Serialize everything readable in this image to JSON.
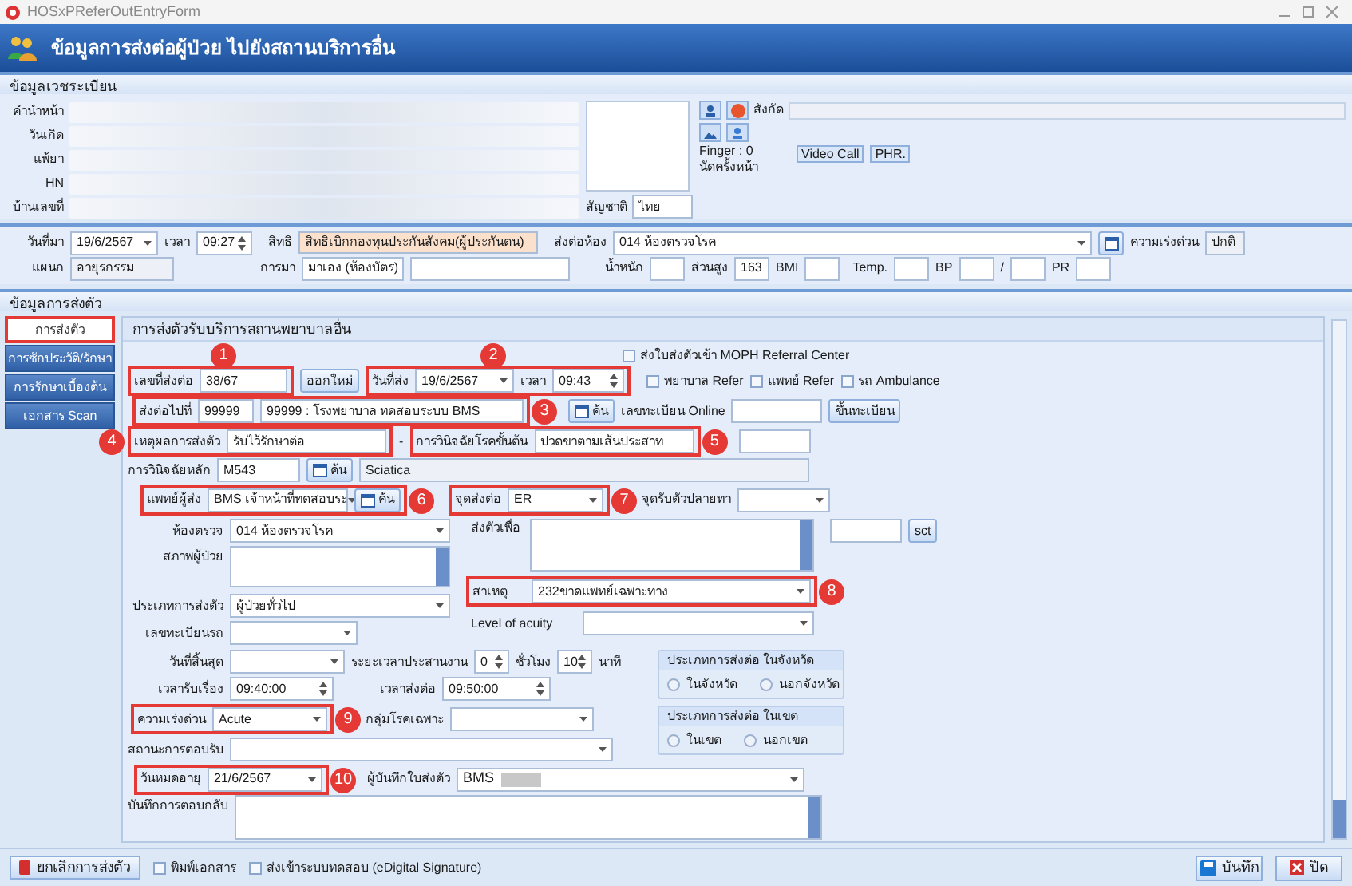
{
  "window": {
    "title": "HOSxPReferOutEntryForm"
  },
  "header": {
    "title": "ข้อมูลการส่งต่อผู้ป่วย ไปยังสถานบริการอื่น"
  },
  "registry": {
    "title": "ข้อมูลเวชระเบียน",
    "labels": [
      "คำนำหน้า",
      "วันเกิด",
      "แพ้ยา",
      "HN",
      "บ้านเลขที่"
    ],
    "affiliation_label": "สังกัด",
    "finger": "Finger : 0",
    "next_appointment_label": "นัดครั้งหน้า",
    "buttons": [
      "Video Call",
      "PHR."
    ],
    "nationality": {
      "label": "สัญชาติ",
      "value": "ไทย"
    }
  },
  "visit": {
    "date": {
      "label": "วันที่มา",
      "value": "19/6/2567"
    },
    "time": {
      "label": "เวลา",
      "value": "09:27"
    },
    "right": {
      "label": "สิทธิ",
      "value": "สิทธิเบิกกองทุนประกันสังคม(ผู้ประกันตน)"
    },
    "room": {
      "label": "ส่งต่อห้อง",
      "value": "014 ห้องตรวจโรค"
    },
    "urgency": {
      "label": "ความเร่งด่วน",
      "value": "ปกติ"
    },
    "department": {
      "label": "แผนก",
      "value": "อายุรกรรม"
    },
    "arrival": {
      "label": "การมา",
      "value": "มาเอง (ห้องบัตร)"
    },
    "weight": {
      "label": "น้ำหนัก"
    },
    "height": {
      "label": "ส่วนสูง",
      "value": "163"
    },
    "bmi": {
      "label": "BMI"
    },
    "temp": {
      "label": "Temp."
    },
    "bp": {
      "label": "BP",
      "separator": "/"
    },
    "pr": {
      "label": "PR"
    }
  },
  "referral": {
    "section_title": "ข้อมูลการส่งตัว",
    "tabs": [
      {
        "label": "การส่งตัว",
        "selected": true
      },
      {
        "label": "การซักประวัติ/รักษา",
        "selected": false
      },
      {
        "label": "การรักษาเบื้องต้น",
        "selected": false
      },
      {
        "label": "เอกสาร Scan",
        "selected": false
      }
    ],
    "group_title": "การส่งตัวรับบริการสถานพยาบาลอื่น",
    "refer_no": {
      "label": "เลขที่ส่งต่อ",
      "value": "38/67"
    },
    "new_button": "ออกใหม่",
    "send_date": {
      "label": "วันที่ส่ง",
      "value": "19/6/2567"
    },
    "send_time": {
      "label": "เวลา",
      "value": "09:43"
    },
    "checks": [
      {
        "label": "ส่งใบส่งตัวเข้า MOPH Referral Center",
        "checked": false
      },
      {
        "label": "พยาบาล Refer",
        "checked": false
      },
      {
        "label": "แพทย์ Refer",
        "checked": false
      },
      {
        "label": "รถ Ambulance",
        "checked": false
      }
    ],
    "destination": {
      "label": "ส่งต่อไปที่",
      "code": "99999",
      "name": "99999 : โรงพยาบาล ทดสอบระบบ BMS",
      "button": "ค้น"
    },
    "online_reg": {
      "label": "เลขทะเบียน Online",
      "button": "ขึ้นทะเบียน"
    },
    "reason": {
      "label": "เหตุผลการส่งตัว",
      "value": "รับไว้รักษาต่อ"
    },
    "dash": "-",
    "initial_dx": {
      "label": "การวินิจฉัยโรคขั้นต้น",
      "value": "ปวดขาตามเส้นประสาท"
    },
    "main_dx": {
      "label": "การวินิจฉัยหลัก",
      "code": "M543",
      "button": "ค้น",
      "name": "Sciatica"
    },
    "doctor": {
      "label": "แพทย์ผู้ส่ง",
      "value": "BMS เจ้าหน้าที่ทดสอบระ",
      "button": "ค้น"
    },
    "send_point": {
      "label": "จุดส่งต่อ",
      "value": "ER"
    },
    "receive_point": {
      "label": "จุดรับตัวปลายทา"
    },
    "exam_room": {
      "label": "ห้องตรวจ",
      "value": "014 ห้องตรวจโรค"
    },
    "purpose": {
      "label": "ส่งตัวเพื่อ",
      "button": "sct"
    },
    "condition": {
      "label": "สภาพผู้ป่วย"
    },
    "refer_type": {
      "label": "ประเภทการส่งตัว",
      "value": "ผู้ป่วยทั่วไป"
    },
    "cause": {
      "label": "สาเหตุ",
      "value": "232ขาดแพทย์เฉพาะทาง"
    },
    "vehicle": {
      "label": "เลขทะเบียนรถ"
    },
    "acuity": {
      "label": "Level of acuity"
    },
    "end_date": {
      "label": "วันที่สิ้นสุด"
    },
    "coordination": {
      "label": "ระยะเวลาประสานงาน",
      "hours": "0",
      "hours_unit": "ชั่วโมง",
      "minutes": "10",
      "minutes_unit": "นาที"
    },
    "receive_time": {
      "label": "เวลารับเรื่อง",
      "value": "09:40:00"
    },
    "refer_time": {
      "label": "เวลาส่งต่อ",
      "value": "09:50:00"
    },
    "severity": {
      "label": "ความเร่งด่วน",
      "value": "Acute"
    },
    "disease_group": {
      "label": "กลุ่มโรคเฉพาะ"
    },
    "response_status": {
      "label": "สถานะการตอบรับ"
    },
    "expiry": {
      "label": "วันหมดอายุ",
      "value": "21/6/2567"
    },
    "recorder": {
      "label": "ผู้บันทึกใบส่งตัว",
      "value": "BMS"
    },
    "reply_note": {
      "label": "บันทึกการตอบกลับ"
    },
    "province_group": {
      "title": "ประเภทการส่งต่อ ในจังหวัด",
      "options": [
        {
          "label": "ในจังหวัด",
          "selected": false
        },
        {
          "label": "นอกจังหวัด",
          "selected": false
        }
      ]
    },
    "region_group": {
      "title": "ประเภทการส่งต่อ ในเขต",
      "options": [
        {
          "label": "ในเขต",
          "selected": false
        },
        {
          "label": "นอกเขต",
          "selected": false
        }
      ]
    }
  },
  "footer": {
    "cancel_button": "ยกเลิกการส่งตัว",
    "checks": [
      {
        "label": "พิมพ์เอกสาร",
        "checked": false
      },
      {
        "label": "ส่งเข้าระบบทดสอบ (eDigital Signature)",
        "checked": false
      }
    ],
    "save_button": "บันทึก",
    "close_button": "ปิด"
  },
  "annotations": [
    "1",
    "2",
    "3",
    "4",
    "5",
    "6",
    "7",
    "8",
    "9",
    "10"
  ]
}
